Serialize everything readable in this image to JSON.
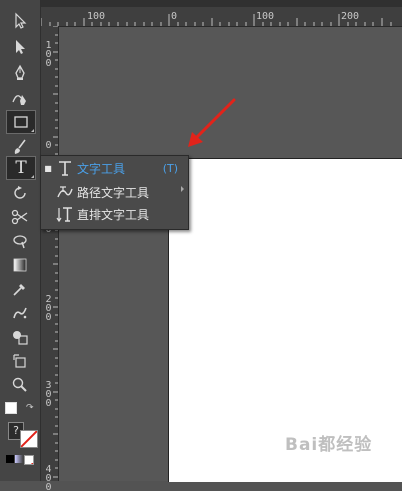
{
  "ruler_top": {
    "ticks": [
      "100",
      "0",
      "100",
      "200"
    ]
  },
  "ruler_left": {
    "ticks": [
      "100",
      "0",
      "100",
      "200",
      "300",
      "400"
    ]
  },
  "toolbar": {
    "tools": [
      {
        "name": "selection-tool",
        "icon": "arrow-icon"
      },
      {
        "name": "direct-selection-tool",
        "icon": "filled-arrow-icon"
      },
      {
        "name": "pen-tool",
        "icon": "pen-icon"
      },
      {
        "name": "curvature-tool",
        "icon": "curvature-pen-icon"
      },
      {
        "name": "rectangle-tool",
        "icon": "rectangle-icon"
      },
      {
        "name": "paintbrush-tool",
        "icon": "brush-icon"
      },
      {
        "name": "type-tool",
        "icon": "type-icon",
        "glyph": "T"
      },
      {
        "name": "rotate-tool",
        "icon": "rotate-icon"
      },
      {
        "name": "scissors-tool",
        "icon": "scissors-icon"
      },
      {
        "name": "warp-tool",
        "icon": "warp-icon"
      },
      {
        "name": "gradient-tool",
        "icon": "gradient-icon"
      },
      {
        "name": "eyedropper-tool",
        "icon": "eyedropper-icon"
      },
      {
        "name": "symbol-sprayer-tool",
        "icon": "sprayer-icon"
      },
      {
        "name": "shape-builder-tool",
        "icon": "shape-builder-icon"
      },
      {
        "name": "artboard-tool",
        "icon": "artboard-icon"
      },
      {
        "name": "zoom-tool",
        "icon": "magnifier-icon"
      }
    ],
    "color_help": "?"
  },
  "flyout": {
    "items": [
      {
        "label": "文字工具",
        "shortcut": "(T)",
        "selected": true
      },
      {
        "label": "路径文字工具",
        "shortcut": "",
        "selected": false
      },
      {
        "label": "直排文字工具",
        "shortcut": "",
        "selected": false
      }
    ]
  },
  "colors": {
    "accent": "#4aa0e8",
    "annotation": "#e2231a",
    "artboard": "#ffffff",
    "canvas": "#575757",
    "panel": "#454545"
  },
  "watermark": "Bai都经验"
}
